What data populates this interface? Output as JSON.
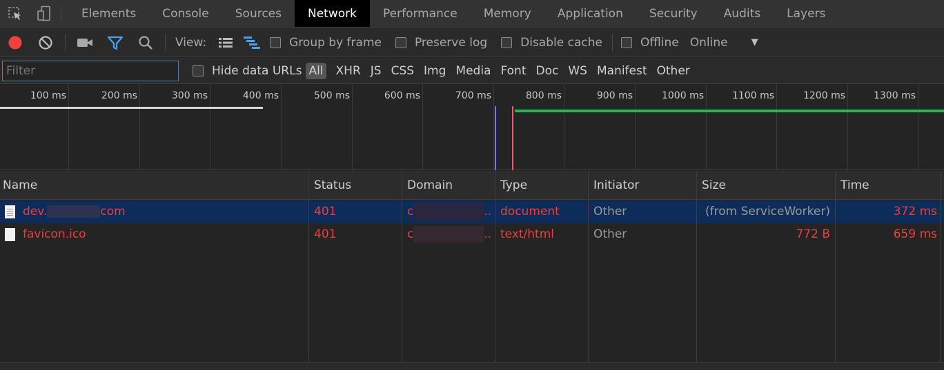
{
  "tabs": [
    "Elements",
    "Console",
    "Sources",
    "Network",
    "Performance",
    "Memory",
    "Application",
    "Security",
    "Audits",
    "Layers"
  ],
  "active_tab": "Network",
  "toolbar": {
    "view_label": "View:",
    "group_by_frame": "Group by frame",
    "preserve_log": "Preserve log",
    "disable_cache": "Disable cache",
    "offline": "Offline",
    "throttle": "Online"
  },
  "filterbar": {
    "filter_placeholder": "Filter",
    "hide_data_urls": "Hide data URLs",
    "types": [
      "All",
      "XHR",
      "JS",
      "CSS",
      "Img",
      "Media",
      "Font",
      "Doc",
      "WS",
      "Manifest",
      "Other"
    ]
  },
  "timeline": {
    "ticks": [
      "100 ms",
      "200 ms",
      "300 ms",
      "400 ms",
      "500 ms",
      "600 ms",
      "700 ms",
      "800 ms",
      "900 ms",
      "1000 ms",
      "1100 ms",
      "1200 ms",
      "1300 ms"
    ]
  },
  "table": {
    "headers": {
      "name": "Name",
      "status": "Status",
      "domain": "Domain",
      "type": "Type",
      "initiator": "Initiator",
      "size": "Size",
      "time": "Time"
    },
    "rows": [
      {
        "name_prefix": "dev.",
        "name_suffix": "com",
        "status": "401",
        "domain_prefix": "c",
        "domain_suffix": "..",
        "type": "document",
        "initiator": "Other",
        "size": "(from ServiceWorker)",
        "time": "372 ms"
      },
      {
        "name": "favicon.ico",
        "status": "401",
        "domain_prefix": "c",
        "domain_suffix": "..",
        "type": "text/html",
        "initiator": "Other",
        "size": "772 B",
        "time": "659 ms"
      }
    ]
  }
}
